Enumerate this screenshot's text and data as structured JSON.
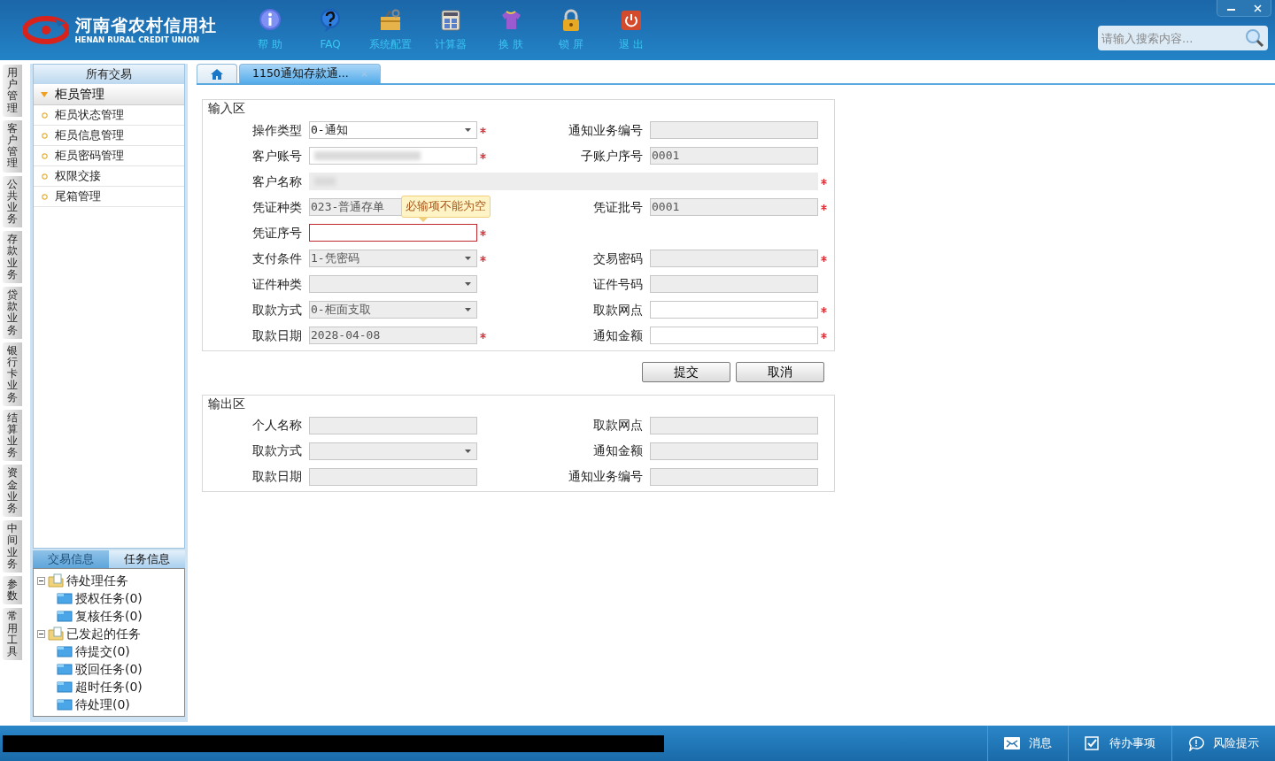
{
  "header": {
    "logo": {
      "name_cn": "河南省农村信用社",
      "name_en": "HENAN RURAL CREDIT UNION"
    },
    "toolbar": [
      {
        "kind": "info",
        "label": "帮 助"
      },
      {
        "kind": "question",
        "label": "FAQ"
      },
      {
        "kind": "toolbox",
        "label": "系统配置"
      },
      {
        "kind": "calculator",
        "label": "计算器"
      },
      {
        "kind": "shirt",
        "label": "换 肤"
      },
      {
        "kind": "lock",
        "label": "锁 屏"
      },
      {
        "kind": "power",
        "label": "退 出"
      }
    ],
    "search": {
      "placeholder": "请输入搜索内容..."
    }
  },
  "left_tabs": [
    "用户管理",
    "客户管理",
    "公共业务",
    "存款业务",
    "贷款业务",
    "银行卡业务",
    "结算业务",
    "资金业务",
    "中间业务",
    "参数",
    "常用工具"
  ],
  "sidebar": {
    "title": "所有交易",
    "group": {
      "label": "柜员管理",
      "expanded": true
    },
    "items": [
      "柜员状态管理",
      "柜员信息管理",
      "柜员密码管理",
      "权限交接",
      "尾箱管理"
    ],
    "bottom_tabs": [
      {
        "label": "交易信息",
        "selected": false
      },
      {
        "label": "任务信息",
        "selected": true
      }
    ],
    "tree": [
      {
        "label": "待处理任务",
        "expanded": true,
        "children": [
          {
            "label": "授权任务(0)"
          },
          {
            "label": "复核任务(0)"
          }
        ]
      },
      {
        "label": "已发起的任务",
        "expanded": true,
        "children": [
          {
            "label": "待提交(0)"
          },
          {
            "label": "驳回任务(0)"
          },
          {
            "label": "超时任务(0)"
          },
          {
            "label": "待处理(0)"
          }
        ]
      }
    ]
  },
  "tabs": [
    {
      "kind": "home",
      "selected": false
    },
    {
      "kind": "page",
      "label": "1150通知存款通...",
      "selected": true
    }
  ],
  "input_area": {
    "title": "输入区",
    "rows": [
      [
        {
          "label": "操作类型",
          "kind": "select",
          "value": "0-通知",
          "disabled": false,
          "required": true
        },
        {
          "label": "通知业务编号",
          "kind": "text",
          "disabled": true,
          "required": false
        }
      ],
      [
        {
          "label": "客户账号",
          "kind": "blurred",
          "disabled": false,
          "required": true
        },
        {
          "label": "子账户序号",
          "kind": "text",
          "value": "0001",
          "disabled": true,
          "required": false
        }
      ],
      [
        {
          "label": "客户名称",
          "kind": "blurred",
          "disabled": true,
          "required": true,
          "wide": true
        }
      ],
      [
        {
          "label": "凭证种类",
          "kind": "text",
          "value": "023-普通存单",
          "disabled": true,
          "required": false
        },
        {
          "label": "凭证批号",
          "kind": "text",
          "value": "0001",
          "disabled": true,
          "required": true
        }
      ],
      [
        {
          "label": "凭证序号",
          "kind": "text",
          "disabled": false,
          "required": true,
          "error": "必输项不能为空"
        }
      ],
      [
        {
          "label": "支付条件",
          "kind": "select",
          "value": "1-凭密码",
          "disabled": true,
          "required": true
        },
        {
          "label": "交易密码",
          "kind": "text",
          "disabled": true,
          "required": true
        }
      ],
      [
        {
          "label": "证件种类",
          "kind": "select",
          "disabled": true,
          "required": false
        },
        {
          "label": "证件号码",
          "kind": "text",
          "disabled": true,
          "required": false
        }
      ],
      [
        {
          "label": "取款方式",
          "kind": "select",
          "value": "0-柜面支取",
          "disabled": true,
          "required": false
        },
        {
          "label": "取款网点",
          "kind": "text",
          "disabled": false,
          "required": true
        }
      ],
      [
        {
          "label": "取款日期",
          "kind": "text",
          "value": "2028-04-08",
          "disabled": true,
          "required": true
        },
        {
          "label": "通知金额",
          "kind": "text",
          "disabled": false,
          "required": true
        }
      ]
    ]
  },
  "buttons": [
    "提交",
    "取消"
  ],
  "output_area": {
    "title": "输出区",
    "rows": [
      [
        {
          "label": "个人名称",
          "kind": "text",
          "disabled": true,
          "required": false
        },
        {
          "label": "取款网点",
          "kind": "text",
          "disabled": true,
          "required": false
        }
      ],
      [
        {
          "label": "取款方式",
          "kind": "select",
          "disabled": true,
          "required": false
        },
        {
          "label": "通知金额",
          "kind": "text",
          "disabled": true,
          "required": false
        }
      ],
      [
        {
          "label": "取款日期",
          "kind": "text",
          "disabled": true,
          "required": false
        },
        {
          "label": "通知业务编号",
          "kind": "text",
          "disabled": true,
          "required": false
        }
      ]
    ]
  },
  "status_bar": {
    "items": [
      {
        "kind": "mail",
        "label": "消息"
      },
      {
        "kind": "check",
        "label": "待办事项"
      },
      {
        "kind": "bubble",
        "label": "风险提示"
      }
    ]
  }
}
